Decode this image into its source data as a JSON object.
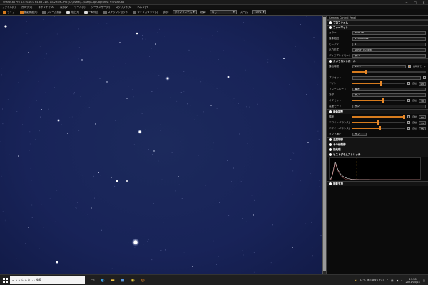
{
  "window": {
    "title": "SharpCap Pro 4.0.9116.0 64-bit  ZWO ASI294MC Pro  (C:\\Users\\...\\SharpCap Captures)  ©SharpCap",
    "controls": [
      "─",
      "□",
      "✕"
    ]
  },
  "menu": [
    "ファイル(F)",
    "カメラ(C)",
    "キャプチャ(A)",
    "表示(V)",
    "ツール(T)",
    "シーケンサー(Q)",
    "スクリプト(S)",
    "ヘルプ(H)"
  ],
  "toolbar": {
    "items": [
      "ライブ",
      "撮影開始(S)",
      "フレーム撮影",
      "停止(P)",
      "一時停止",
      "スナップショット",
      "ライブスタック(L)"
    ],
    "zoom_label": "ズーム:",
    "zoom_value": "100%",
    "display_label": "表示: ",
    "display_value": "ライブフレーム",
    "mode_label": "効果:",
    "mode_value": "なし"
  },
  "panel": {
    "title": "Camera Control Panel",
    "sections": {
      "profile": "プロファイル",
      "format": "フォーマット",
      "camera_control": "カメラコントロール",
      "image_control": "画像調整",
      "thermal": "温度制御",
      "misc": "その他制御",
      "preprocess": "前処理",
      "histogram": "ヒストグラムストレッチ",
      "capture_tools": "撮影支援"
    },
    "format_rows": [
      {
        "label": "カラー",
        "value": "RGB 16"
      },
      {
        "label": "撮像範囲",
        "value": "4144x2822"
      },
      {
        "label": "ビニング",
        "value": "1"
      },
      {
        "label": "出力形式",
        "value": "SER/FITS(自動)"
      },
      {
        "label": "ディスプレイモード",
        "value": "オン"
      }
    ],
    "exposure": {
      "label": "露出時間",
      "value": "4.0 s",
      "lx_label": "長時間モード",
      "slider": 0.18
    },
    "pause_label": "プリセット",
    "camera_rows": [
      {
        "label": "ゲイン",
        "slider": 0.55,
        "auto": "自動",
        "value": "120"
      },
      {
        "label": "フレームレート",
        "value": "最大"
      },
      {
        "label": "冷却",
        "value": "オフ"
      },
      {
        "label": "オフセット",
        "slider": 0.58,
        "auto": "自動",
        "value": "30"
      },
      {
        "label": "高速モード",
        "value": "オン"
      }
    ],
    "image_rows": [
      {
        "label": "輝度",
        "slider": 0.98,
        "auto": "自動",
        "value": "50"
      },
      {
        "label": "ホワイトバランス(R)",
        "slider": 0.5,
        "auto": "自動",
        "value": "53"
      },
      {
        "label": "ホワイトバランス(B)",
        "slider": 0.52,
        "auto": "自動",
        "value": "55"
      },
      {
        "label": "ガンマ補正",
        "value": "オフ"
      }
    ]
  },
  "taskbar": {
    "search_placeholder": "ここに入力して検索",
    "weather": "22°C  晴れ時々くもり",
    "time": "19:58",
    "date": "2021/05/24"
  },
  "histogram_data": {
    "peak_fraction": 0.9,
    "peak_position_fraction": 0.06,
    "stretch_marker": 0.3
  },
  "colors": {
    "accent": "#d67b1e",
    "sky": "#182358",
    "panel": "#0b0b0b"
  }
}
